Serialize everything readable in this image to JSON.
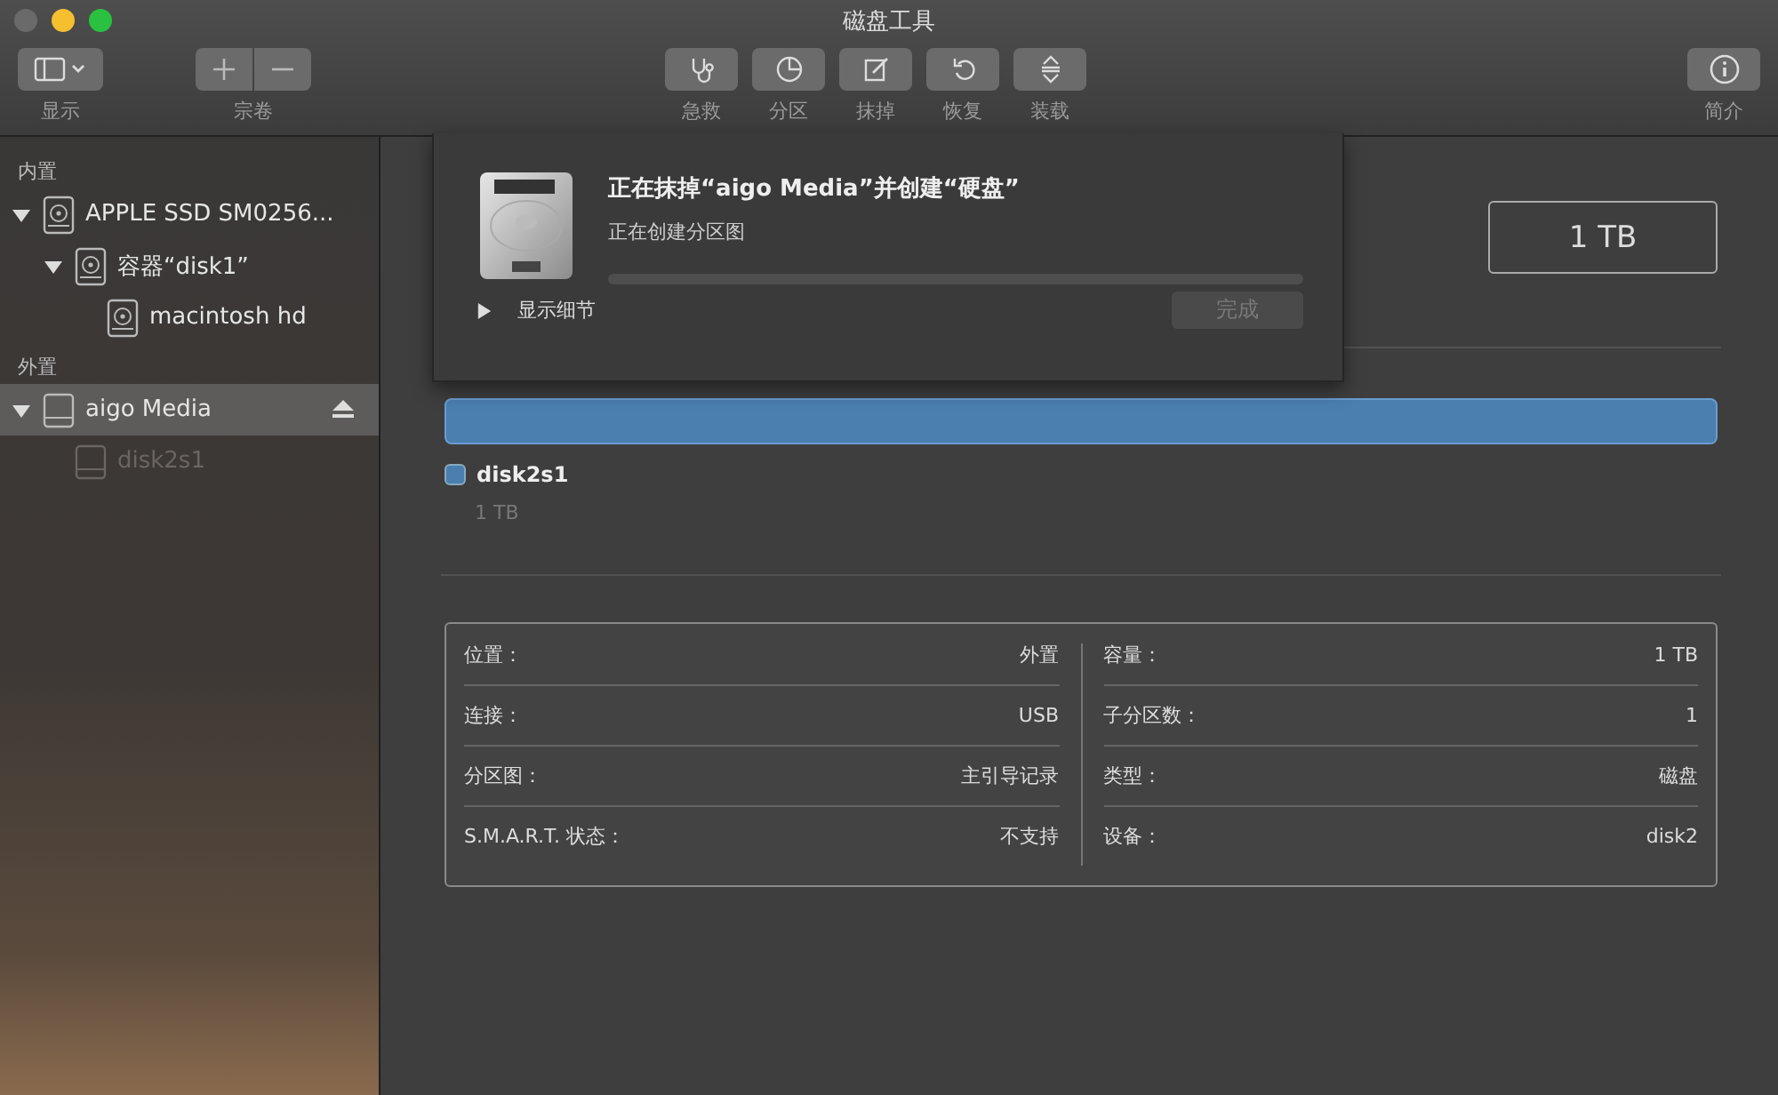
{
  "window": {
    "title": "磁盘工具"
  },
  "toolbar": {
    "left": [
      {
        "label": "显示",
        "kind": "view"
      },
      {
        "label": "宗卷",
        "kind": "volume"
      }
    ],
    "center": [
      {
        "label": "急救",
        "kind": "firstaid"
      },
      {
        "label": "分区",
        "kind": "partition"
      },
      {
        "label": "抹掉",
        "kind": "erase"
      },
      {
        "label": "恢复",
        "kind": "restore"
      },
      {
        "label": "装载",
        "kind": "mount"
      }
    ],
    "right": [
      {
        "label": "简介",
        "kind": "info"
      }
    ]
  },
  "sidebar": {
    "sections": [
      {
        "heading": "内置",
        "items": [
          {
            "label": "APPLE SSD SM0256...",
            "kind": "internal",
            "selected": false,
            "expanded": true,
            "ejectable": false,
            "dimmed": false,
            "children": [
              {
                "label": "容器“disk1”",
                "kind": "internal",
                "selected": false,
                "expanded": true,
                "ejectable": false,
                "dimmed": false,
                "children": [
                  {
                    "label": "macintosh hd",
                    "kind": "internal",
                    "selected": false,
                    "expanded": false,
                    "ejectable": false,
                    "dimmed": false
                  }
                ]
              }
            ]
          }
        ]
      },
      {
        "heading": "外置",
        "items": [
          {
            "label": "aigo Media",
            "kind": "external",
            "selected": true,
            "expanded": true,
            "ejectable": true,
            "dimmed": false,
            "children": [
              {
                "label": "disk2s1",
                "kind": "external",
                "selected": false,
                "expanded": false,
                "ejectable": false,
                "dimmed": true
              }
            ]
          }
        ]
      }
    ]
  },
  "capacity": "1 TB",
  "partition": {
    "name": "disk2s1",
    "size": "1 TB",
    "color": "#4a7fb0"
  },
  "info": {
    "left": [
      {
        "label": "位置：",
        "value": "外置"
      },
      {
        "label": "连接：",
        "value": "USB"
      },
      {
        "label": "分区图：",
        "value": "主引导记录"
      },
      {
        "label": "S.M.A.R.T. 状态：",
        "value": "不支持"
      }
    ],
    "right": [
      {
        "label": "容量：",
        "value": "1 TB"
      },
      {
        "label": "子分区数：",
        "value": "1"
      },
      {
        "label": "类型：",
        "value": "磁盘"
      },
      {
        "label": "设备：",
        "value": "disk2"
      }
    ]
  },
  "sheet": {
    "title": "正在抹掉“aigo Media”并创建“硬盘”",
    "status": "正在创建分区图",
    "progress": {
      "level": 0
    },
    "details": {
      "label": "显示细节",
      "expanded": false
    },
    "done_button": {
      "label": "完成",
      "disabled": true
    }
  }
}
